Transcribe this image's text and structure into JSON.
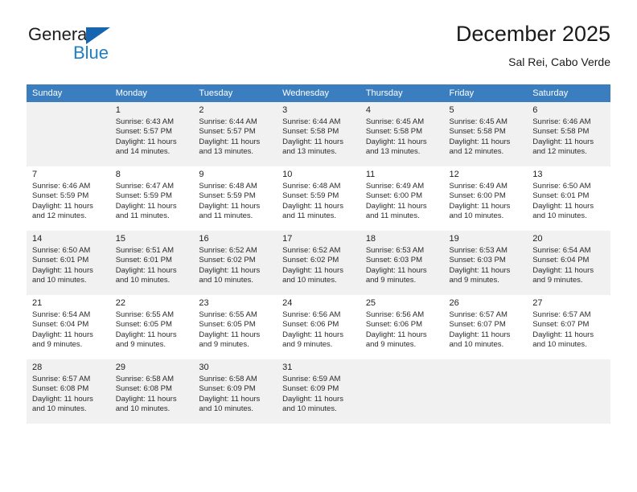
{
  "brand": {
    "name_top": "General",
    "name_bottom": "Blue",
    "accent_color": "#1f7ec4",
    "triangle_color": "#1565b0"
  },
  "header": {
    "title": "December 2025",
    "subtitle": "Sal Rei, Cabo Verde"
  },
  "calendar": {
    "header_bg": "#3b7ec0",
    "shaded_row_bg": "#f1f1f1",
    "weekday_headers": [
      "Sunday",
      "Monday",
      "Tuesday",
      "Wednesday",
      "Thursday",
      "Friday",
      "Saturday"
    ],
    "weeks": [
      [
        {
          "day": "",
          "lines": []
        },
        {
          "day": "1",
          "lines": [
            "Sunrise: 6:43 AM",
            "Sunset: 5:57 PM",
            "Daylight: 11 hours",
            "and 14 minutes."
          ]
        },
        {
          "day": "2",
          "lines": [
            "Sunrise: 6:44 AM",
            "Sunset: 5:57 PM",
            "Daylight: 11 hours",
            "and 13 minutes."
          ]
        },
        {
          "day": "3",
          "lines": [
            "Sunrise: 6:44 AM",
            "Sunset: 5:58 PM",
            "Daylight: 11 hours",
            "and 13 minutes."
          ]
        },
        {
          "day": "4",
          "lines": [
            "Sunrise: 6:45 AM",
            "Sunset: 5:58 PM",
            "Daylight: 11 hours",
            "and 13 minutes."
          ]
        },
        {
          "day": "5",
          "lines": [
            "Sunrise: 6:45 AM",
            "Sunset: 5:58 PM",
            "Daylight: 11 hours",
            "and 12 minutes."
          ]
        },
        {
          "day": "6",
          "lines": [
            "Sunrise: 6:46 AM",
            "Sunset: 5:58 PM",
            "Daylight: 11 hours",
            "and 12 minutes."
          ]
        }
      ],
      [
        {
          "day": "7",
          "lines": [
            "Sunrise: 6:46 AM",
            "Sunset: 5:59 PM",
            "Daylight: 11 hours",
            "and 12 minutes."
          ]
        },
        {
          "day": "8",
          "lines": [
            "Sunrise: 6:47 AM",
            "Sunset: 5:59 PM",
            "Daylight: 11 hours",
            "and 11 minutes."
          ]
        },
        {
          "day": "9",
          "lines": [
            "Sunrise: 6:48 AM",
            "Sunset: 5:59 PM",
            "Daylight: 11 hours",
            "and 11 minutes."
          ]
        },
        {
          "day": "10",
          "lines": [
            "Sunrise: 6:48 AM",
            "Sunset: 5:59 PM",
            "Daylight: 11 hours",
            "and 11 minutes."
          ]
        },
        {
          "day": "11",
          "lines": [
            "Sunrise: 6:49 AM",
            "Sunset: 6:00 PM",
            "Daylight: 11 hours",
            "and 11 minutes."
          ]
        },
        {
          "day": "12",
          "lines": [
            "Sunrise: 6:49 AM",
            "Sunset: 6:00 PM",
            "Daylight: 11 hours",
            "and 10 minutes."
          ]
        },
        {
          "day": "13",
          "lines": [
            "Sunrise: 6:50 AM",
            "Sunset: 6:01 PM",
            "Daylight: 11 hours",
            "and 10 minutes."
          ]
        }
      ],
      [
        {
          "day": "14",
          "lines": [
            "Sunrise: 6:50 AM",
            "Sunset: 6:01 PM",
            "Daylight: 11 hours",
            "and 10 minutes."
          ]
        },
        {
          "day": "15",
          "lines": [
            "Sunrise: 6:51 AM",
            "Sunset: 6:01 PM",
            "Daylight: 11 hours",
            "and 10 minutes."
          ]
        },
        {
          "day": "16",
          "lines": [
            "Sunrise: 6:52 AM",
            "Sunset: 6:02 PM",
            "Daylight: 11 hours",
            "and 10 minutes."
          ]
        },
        {
          "day": "17",
          "lines": [
            "Sunrise: 6:52 AM",
            "Sunset: 6:02 PM",
            "Daylight: 11 hours",
            "and 10 minutes."
          ]
        },
        {
          "day": "18",
          "lines": [
            "Sunrise: 6:53 AM",
            "Sunset: 6:03 PM",
            "Daylight: 11 hours",
            "and 9 minutes."
          ]
        },
        {
          "day": "19",
          "lines": [
            "Sunrise: 6:53 AM",
            "Sunset: 6:03 PM",
            "Daylight: 11 hours",
            "and 9 minutes."
          ]
        },
        {
          "day": "20",
          "lines": [
            "Sunrise: 6:54 AM",
            "Sunset: 6:04 PM",
            "Daylight: 11 hours",
            "and 9 minutes."
          ]
        }
      ],
      [
        {
          "day": "21",
          "lines": [
            "Sunrise: 6:54 AM",
            "Sunset: 6:04 PM",
            "Daylight: 11 hours",
            "and 9 minutes."
          ]
        },
        {
          "day": "22",
          "lines": [
            "Sunrise: 6:55 AM",
            "Sunset: 6:05 PM",
            "Daylight: 11 hours",
            "and 9 minutes."
          ]
        },
        {
          "day": "23",
          "lines": [
            "Sunrise: 6:55 AM",
            "Sunset: 6:05 PM",
            "Daylight: 11 hours",
            "and 9 minutes."
          ]
        },
        {
          "day": "24",
          "lines": [
            "Sunrise: 6:56 AM",
            "Sunset: 6:06 PM",
            "Daylight: 11 hours",
            "and 9 minutes."
          ]
        },
        {
          "day": "25",
          "lines": [
            "Sunrise: 6:56 AM",
            "Sunset: 6:06 PM",
            "Daylight: 11 hours",
            "and 9 minutes."
          ]
        },
        {
          "day": "26",
          "lines": [
            "Sunrise: 6:57 AM",
            "Sunset: 6:07 PM",
            "Daylight: 11 hours",
            "and 10 minutes."
          ]
        },
        {
          "day": "27",
          "lines": [
            "Sunrise: 6:57 AM",
            "Sunset: 6:07 PM",
            "Daylight: 11 hours",
            "and 10 minutes."
          ]
        }
      ],
      [
        {
          "day": "28",
          "lines": [
            "Sunrise: 6:57 AM",
            "Sunset: 6:08 PM",
            "Daylight: 11 hours",
            "and 10 minutes."
          ]
        },
        {
          "day": "29",
          "lines": [
            "Sunrise: 6:58 AM",
            "Sunset: 6:08 PM",
            "Daylight: 11 hours",
            "and 10 minutes."
          ]
        },
        {
          "day": "30",
          "lines": [
            "Sunrise: 6:58 AM",
            "Sunset: 6:09 PM",
            "Daylight: 11 hours",
            "and 10 minutes."
          ]
        },
        {
          "day": "31",
          "lines": [
            "Sunrise: 6:59 AM",
            "Sunset: 6:09 PM",
            "Daylight: 11 hours",
            "and 10 minutes."
          ]
        },
        {
          "day": "",
          "lines": []
        },
        {
          "day": "",
          "lines": []
        },
        {
          "day": "",
          "lines": []
        }
      ]
    ]
  }
}
